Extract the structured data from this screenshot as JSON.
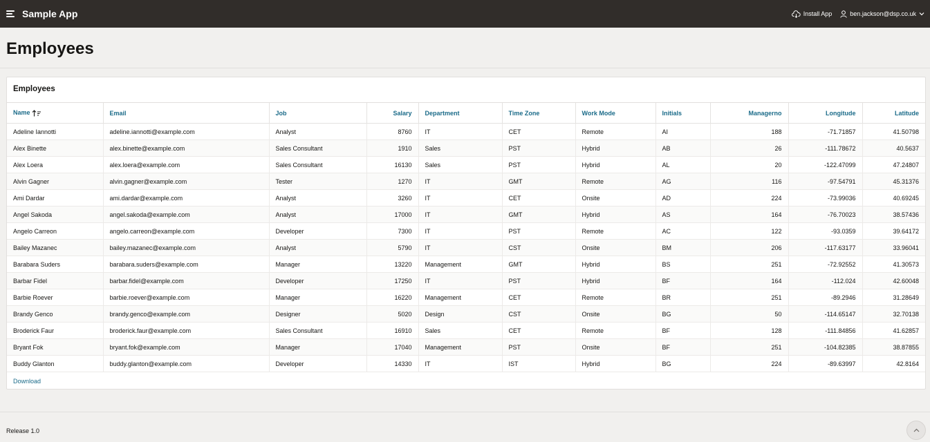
{
  "header": {
    "app_title": "Sample App",
    "install_label": "Install App",
    "install_icon": "cloud-download-icon",
    "user_label": "ben.jackson@dsp.co.uk",
    "user_icon": "user-icon",
    "bg_color": "#312d2a"
  },
  "page": {
    "title": "Employees"
  },
  "region": {
    "title": "Employees",
    "download_label": "Download",
    "sorted_column": "Name",
    "sort_direction": "ascending",
    "columns": [
      {
        "key": "name",
        "label": "Name"
      },
      {
        "key": "email",
        "label": "Email"
      },
      {
        "key": "job",
        "label": "Job"
      },
      {
        "key": "salary",
        "label": "Salary"
      },
      {
        "key": "department",
        "label": "Department"
      },
      {
        "key": "timezone",
        "label": "Time Zone"
      },
      {
        "key": "workmode",
        "label": "Work Mode"
      },
      {
        "key": "initials",
        "label": "Initials"
      },
      {
        "key": "managerno",
        "label": "Managerno"
      },
      {
        "key": "longitude",
        "label": "Longitude"
      },
      {
        "key": "latitude",
        "label": "Latitude"
      }
    ],
    "rows": [
      [
        "Adeline Iannotti",
        "adeline.iannotti@example.com",
        "Analyst",
        "8760",
        "IT",
        "CET",
        "Remote",
        "AI",
        "188",
        "-71.71857",
        "41.50798"
      ],
      [
        "Alex Binette",
        "alex.binette@example.com",
        "Sales Consultant",
        "1910",
        "Sales",
        "PST",
        "Hybrid",
        "AB",
        "26",
        "-111.78672",
        "40.5637"
      ],
      [
        "Alex Loera",
        "alex.loera@example.com",
        "Sales Consultant",
        "16130",
        "Sales",
        "PST",
        "Hybrid",
        "AL",
        "20",
        "-122.47099",
        "47.24807"
      ],
      [
        "Alvin Gagner",
        "alvin.gagner@example.com",
        "Tester",
        "1270",
        "IT",
        "GMT",
        "Remote",
        "AG",
        "116",
        "-97.54791",
        "45.31376"
      ],
      [
        "Ami Dardar",
        "ami.dardar@example.com",
        "Analyst",
        "3260",
        "IT",
        "CET",
        "Onsite",
        "AD",
        "224",
        "-73.99036",
        "40.69245"
      ],
      [
        "Angel Sakoda",
        "angel.sakoda@example.com",
        "Analyst",
        "17000",
        "IT",
        "GMT",
        "Hybrid",
        "AS",
        "164",
        "-76.70023",
        "38.57436"
      ],
      [
        "Angelo Carreon",
        "angelo.carreon@example.com",
        "Developer",
        "7300",
        "IT",
        "PST",
        "Remote",
        "AC",
        "122",
        "-93.0359",
        "39.64172"
      ],
      [
        "Bailey Mazanec",
        "bailey.mazanec@example.com",
        "Analyst",
        "5790",
        "IT",
        "CST",
        "Onsite",
        "BM",
        "206",
        "-117.63177",
        "33.96041"
      ],
      [
        "Barabara Suders",
        "barabara.suders@example.com",
        "Manager",
        "13220",
        "Management",
        "GMT",
        "Hybrid",
        "BS",
        "251",
        "-72.92552",
        "41.30573"
      ],
      [
        "Barbar Fidel",
        "barbar.fidel@example.com",
        "Developer",
        "17250",
        "IT",
        "PST",
        "Hybrid",
        "BF",
        "164",
        "-112.024",
        "42.60048"
      ],
      [
        "Barbie Roever",
        "barbie.roever@example.com",
        "Manager",
        "16220",
        "Management",
        "CET",
        "Remote",
        "BR",
        "251",
        "-89.2946",
        "31.28649"
      ],
      [
        "Brandy Genco",
        "brandy.genco@example.com",
        "Designer",
        "5020",
        "Design",
        "CST",
        "Onsite",
        "BG",
        "50",
        "-114.65147",
        "32.70138"
      ],
      [
        "Broderick Faur",
        "broderick.faur@example.com",
        "Sales Consultant",
        "16910",
        "Sales",
        "CET",
        "Remote",
        "BF",
        "128",
        "-111.84856",
        "41.62857"
      ],
      [
        "Bryant Fok",
        "bryant.fok@example.com",
        "Manager",
        "17040",
        "Management",
        "PST",
        "Onsite",
        "BF",
        "251",
        "-104.82385",
        "38.87855"
      ],
      [
        "Buddy Glanton",
        "buddy.glanton@example.com",
        "Developer",
        "14330",
        "IT",
        "IST",
        "Hybrid",
        "BG",
        "224",
        "-89.63997",
        "42.8164"
      ]
    ]
  },
  "footer": {
    "release_label": "Release 1.0",
    "scroll_top_icon": "chevron-up-icon"
  }
}
